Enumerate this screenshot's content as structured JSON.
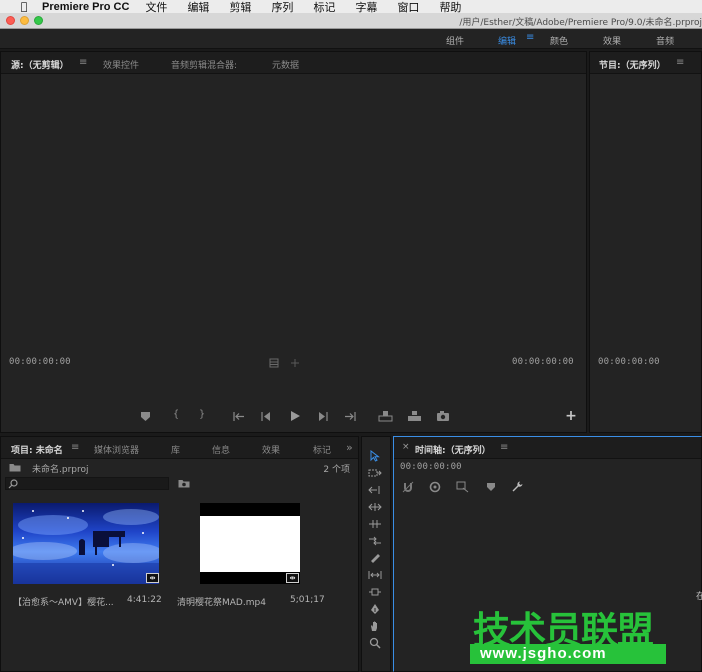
{
  "menubar": {
    "apple_icon": "apple-icon",
    "app_name": "Premiere Pro CC",
    "items": [
      "文件",
      "编辑",
      "剪辑",
      "序列",
      "标记",
      "字幕",
      "窗口",
      "帮助"
    ]
  },
  "titlebar": {
    "path": "/用户/Esther/文稿/Adobe/Premiere Pro/9.0/未命名.prproj"
  },
  "workspaces": {
    "items": [
      "组件",
      "编辑",
      "颜色",
      "效果",
      "音频"
    ],
    "active": "编辑"
  },
  "source_panel": {
    "tabs": [
      "源:（无剪辑）",
      "效果控件",
      "音频剪辑混合器:",
      "元数据"
    ],
    "timecode_left": "00:00:00:00",
    "timecode_right": "00:00:00:00",
    "controls": [
      "marker-icon",
      "mark-in-icon",
      "mark-out-icon",
      "go-to-in-icon",
      "step-back-icon",
      "play-icon",
      "step-forward-icon",
      "go-to-out-icon",
      "insert-icon",
      "overwrite-icon",
      "export-frame-icon",
      "add-button-icon"
    ]
  },
  "program_panel": {
    "tab": "节目:（无序列）",
    "timecode": "00:00:00:00"
  },
  "project_panel": {
    "tabs": [
      "项目: 未命名",
      "媒体浏览器",
      "库",
      "信息",
      "效果",
      "标记"
    ],
    "more": "»",
    "project_file": "未命名.prproj",
    "item_count": "2 个项",
    "clips": [
      {
        "name": "【治愈系～AMV】樱花...",
        "duration": "4:41:22"
      },
      {
        "name": "清明樱花祭MAD.mp4",
        "duration": "5;01;17"
      }
    ]
  },
  "timeline_panel": {
    "tab": "时间轴:（无序列）",
    "timecode": "00:00:00:00",
    "side_text": "在"
  },
  "watermark": {
    "title": "技术员联盟",
    "url": "www.jsgho.com"
  },
  "colors": {
    "accent_blue": "#3a8ee6",
    "watermark_green": "#27c23a"
  }
}
